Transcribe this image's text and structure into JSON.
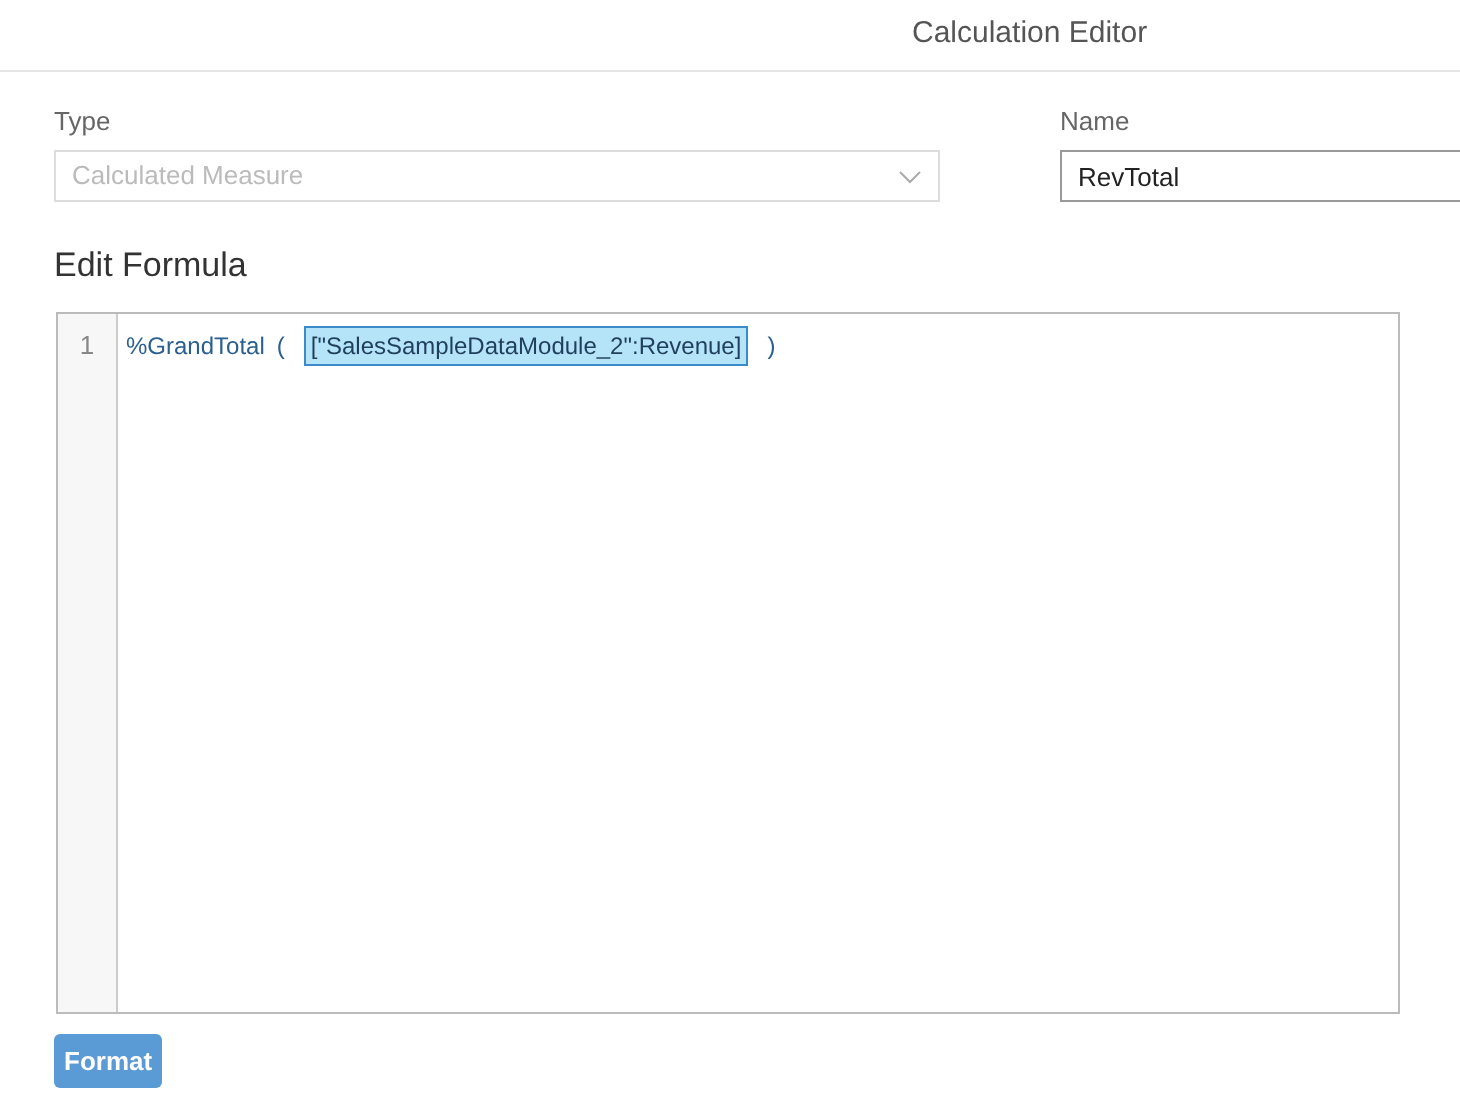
{
  "dialog": {
    "title": "Calculation Editor"
  },
  "type_field": {
    "label": "Type",
    "value": "Calculated Measure",
    "disabled": true
  },
  "name_field": {
    "label": "Name",
    "value": "RevTotal"
  },
  "formula": {
    "heading": "Edit Formula",
    "lines": [
      {
        "number": "1",
        "tokens": [
          {
            "kind": "function",
            "text": "%GrandTotal"
          },
          {
            "kind": "paren",
            "text": "("
          },
          {
            "kind": "reference",
            "text": "[\"SalesSampleDataModule_2\":Revenue]"
          },
          {
            "kind": "paren",
            "text": ")"
          }
        ]
      }
    ]
  },
  "buttons": [
    {
      "label": "Format"
    }
  ]
}
